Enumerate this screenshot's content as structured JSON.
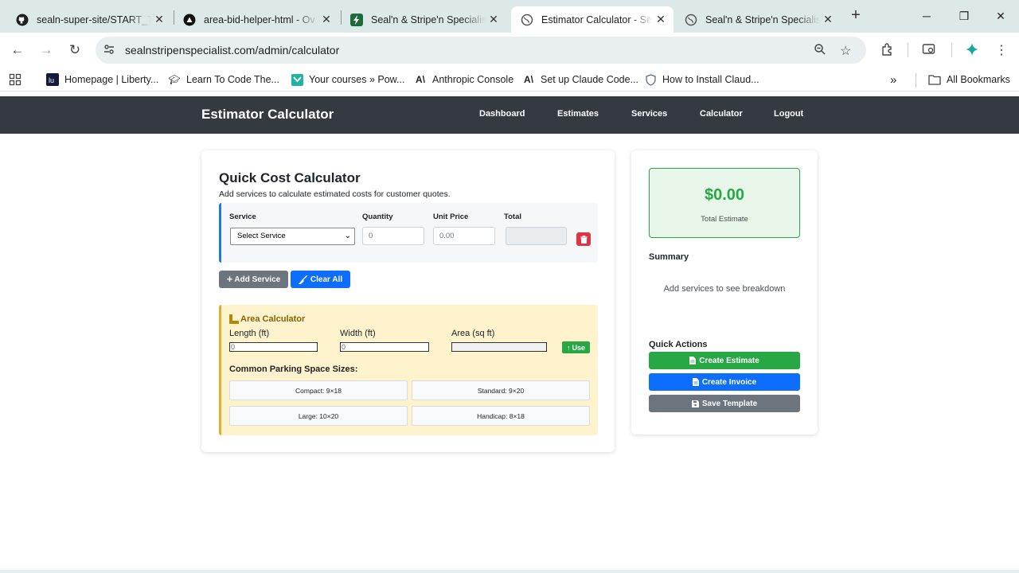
{
  "browser": {
    "tabs": [
      {
        "title": "sealn-super-site/START_TO",
        "icon": "github-icon"
      },
      {
        "title": "area-bid-helper-html - Ov",
        "icon": "vercel-icon"
      },
      {
        "title": "Seal'n & Stripe'n Specialist",
        "icon": "bolt-icon"
      },
      {
        "title": "Estimator Calculator - Seal",
        "icon": "globe-icon",
        "active": true
      },
      {
        "title": "Seal'n & Stripe'n Specialist",
        "icon": "globe-icon"
      }
    ],
    "url": "sealnstripenspecialist.com/admin/calculator",
    "bookmarks": [
      "Homepage | Liberty...",
      "Learn To Code The...",
      "Your courses » Pow...",
      "Anthropic Console",
      "Set up Claude Code...",
      "How to Install Claud..."
    ],
    "all_bookmarks": "All Bookmarks"
  },
  "app": {
    "brand": "Estimator Calculator",
    "nav": [
      "Dashboard",
      "Estimates",
      "Services",
      "Calculator",
      "Logout"
    ]
  },
  "calculator": {
    "title": "Quick Cost Calculator",
    "subtitle": "Add services to calculate estimated costs for customer quotes.",
    "columns": {
      "service": "Service",
      "quantity": "Quantity",
      "unit_price": "Unit Price",
      "total": "Total"
    },
    "service_select": "Select Service",
    "quantity_placeholder": "0",
    "unit_price_placeholder": "0.00",
    "add_service": "Add Service",
    "clear_all": "Clear All"
  },
  "area": {
    "title": "Area Calculator",
    "length_label": "Length (ft)",
    "width_label": "Width (ft)",
    "area_label": "Area (sq ft)",
    "length_placeholder": "0",
    "width_placeholder": "0",
    "use_button": "Use",
    "common_title": "Common Parking Space Sizes:",
    "sizes": [
      "Compact: 9×18",
      "Standard: 9×20",
      "Large: 10×20",
      "Handicap: 8×18"
    ]
  },
  "sidebar": {
    "total_amount": "$0.00",
    "total_label": "Total Estimate",
    "summary_title": "Summary",
    "summary_empty": "Add services to see breakdown",
    "quick_actions_title": "Quick Actions",
    "create_estimate": "Create Estimate",
    "create_invoice": "Create Invoice",
    "save_template": "Save Template"
  },
  "colors": {
    "navbar": "#343a40",
    "success": "#28a745",
    "primary": "#0d6efd",
    "secondary": "#6c757d",
    "danger": "#dc3545",
    "warning_bg": "#fff3cd"
  }
}
